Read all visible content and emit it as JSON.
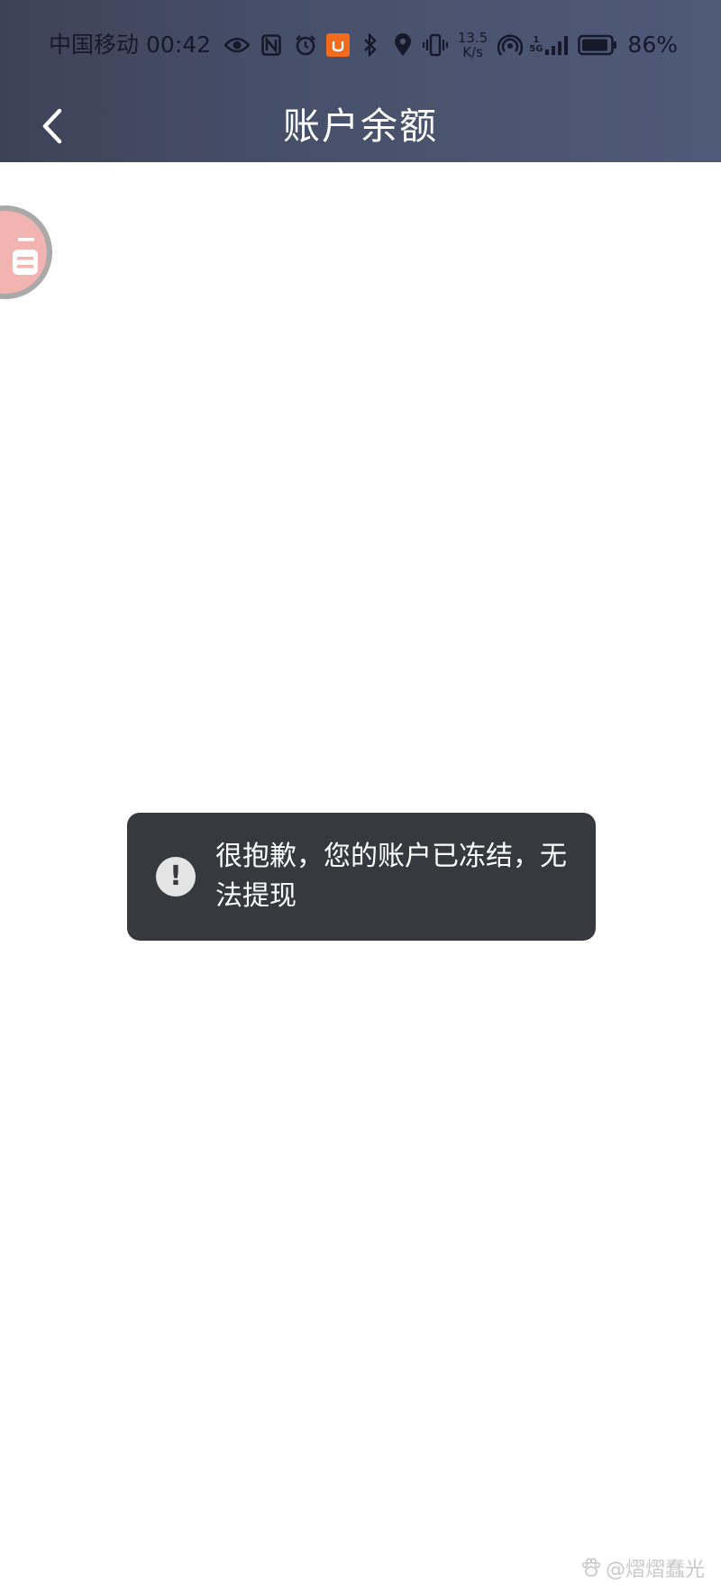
{
  "status_bar": {
    "carrier": "中国移动",
    "time": "00:42",
    "net_speed_value": "13.5",
    "net_speed_unit": "K/s",
    "signal_labels": {
      "sim1": "1",
      "network": "5G"
    },
    "battery_percent": "86%",
    "left_icons": [
      "eye-icon",
      "nfc-icon",
      "alarm-icon",
      "didi-app-icon"
    ],
    "right_icons": [
      "bluetooth-icon",
      "location-icon",
      "vibrate-icon",
      "hotspot-icon",
      "cellular-signal-icon",
      "battery-icon"
    ]
  },
  "nav": {
    "back_icon": "chevron-left-icon",
    "title": "账户余额"
  },
  "float_bubble": {
    "icon": "floating-assistant-icon"
  },
  "toast": {
    "icon": "exclamation-icon",
    "message": "很抱歉，您的账户已冻结，无法提现"
  },
  "watermark": {
    "icon": "paw-icon",
    "text": "@熠熠蠢光"
  },
  "colors": {
    "header_gradient_start": "#3d4357",
    "header_gradient_end": "#4f5a78",
    "toast_background": "#38393e",
    "toast_icon_background": "#e4e4e4",
    "didi_orange": "#f26a1b",
    "bubble_pink": "#f2b4b0"
  }
}
